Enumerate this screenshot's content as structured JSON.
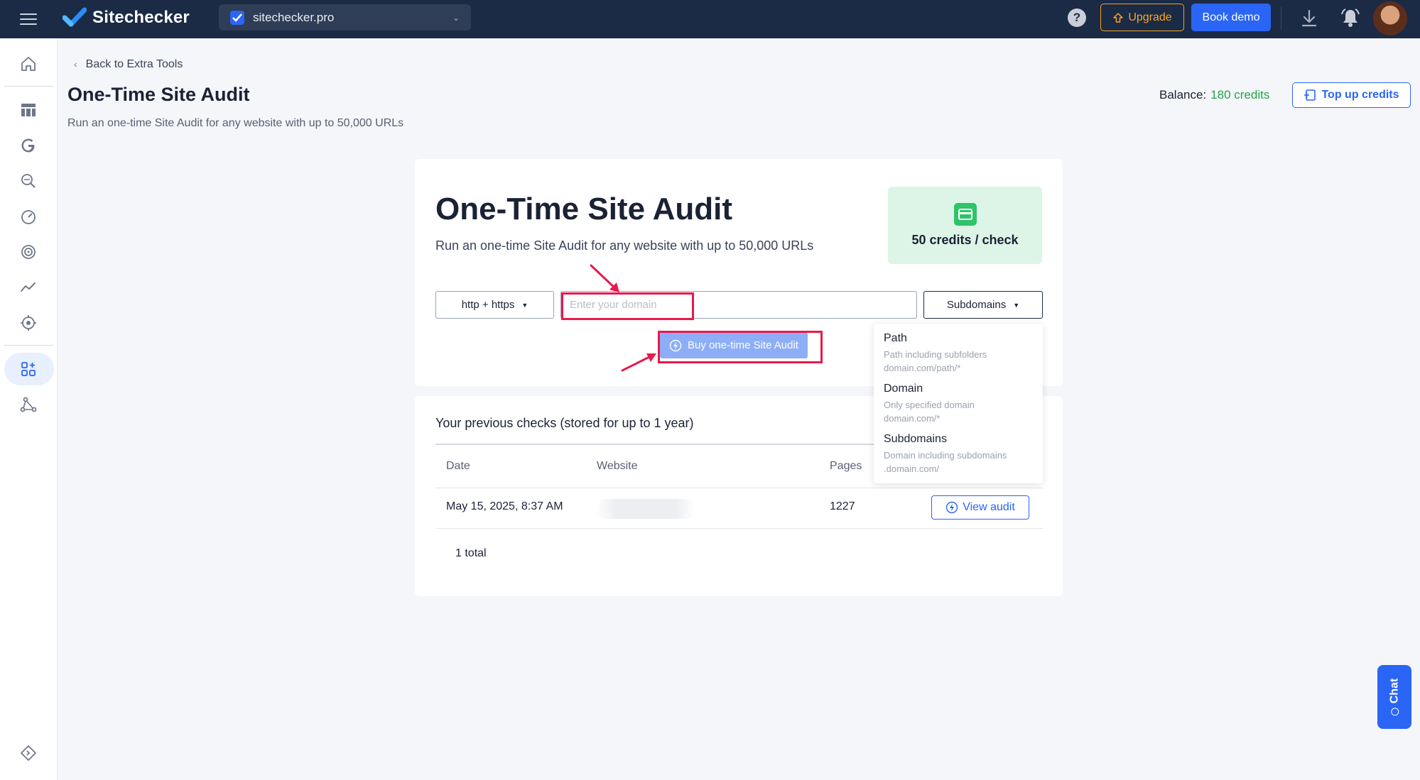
{
  "app": {
    "name": "Sitechecker",
    "site_selector": "sitechecker.pro",
    "help": "?",
    "upgrade_label": "Upgrade",
    "book_demo_label": "Book demo"
  },
  "header": {
    "back_link": "Back to Extra Tools",
    "title": "One-Time Site Audit",
    "subtitle": "Run an one-time Site Audit for any website with up to 50,000 URLs",
    "balance_label": "Balance:",
    "balance_value": "180 credits",
    "topup_label": "Top up credits"
  },
  "audit_card": {
    "title": "One-Time Site Audit",
    "subtitle": "Run an one-time Site Audit for any website with up to 50,000 URLs",
    "credits_text": "50 credits / check",
    "protocol_value": "http + https",
    "domain_placeholder": "Enter your domain",
    "scope_value": "Subdomains",
    "buy_label": "Buy one-time Site Audit"
  },
  "scope_dropdown": [
    {
      "title": "Path",
      "line1": "Path including subfolders",
      "line2": "domain.com/path/*"
    },
    {
      "title": "Domain",
      "line1": "Only specified domain",
      "line2": "domain.com/*"
    },
    {
      "title": "Subdomains",
      "line1": "Domain including subdomains",
      "line2": ".domain.com/"
    }
  ],
  "previous_checks": {
    "title": "Your previous checks (stored for up to 1 year)",
    "columns": [
      "Date",
      "Website",
      "Pages"
    ],
    "rows": [
      {
        "date": "May 15, 2025, 8:37 AM",
        "pages": "1227",
        "action": "View audit"
      }
    ],
    "total": "1 total"
  },
  "chat_label": "Chat",
  "colors": {
    "topbar": "#1b2a45",
    "accent": "#2a65f5",
    "upgrade": "#f5a623",
    "credits_green": "#22a447",
    "highlight": "#e8194d"
  }
}
